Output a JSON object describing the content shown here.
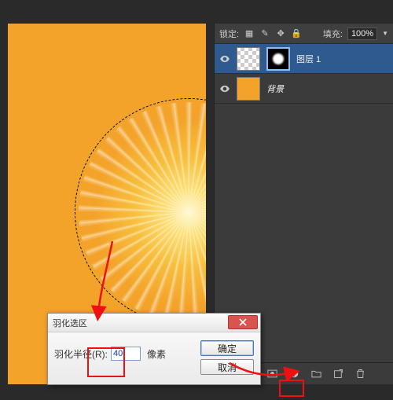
{
  "topbar": {},
  "canvas": {},
  "layers_panel": {
    "lock_label": "锁定:",
    "fill_label": "填充:",
    "fill_value": "100%",
    "layers": [
      {
        "name": "图层 1"
      },
      {
        "name": "背景"
      }
    ]
  },
  "dialog": {
    "title": "羽化选区",
    "radius_label": "羽化半径(R):",
    "radius_value": "40",
    "unit": "像素",
    "ok": "确定",
    "cancel": "取消"
  },
  "footer_icons": [
    "link",
    "fx",
    "mask",
    "adjust",
    "group",
    "new",
    "trash"
  ]
}
